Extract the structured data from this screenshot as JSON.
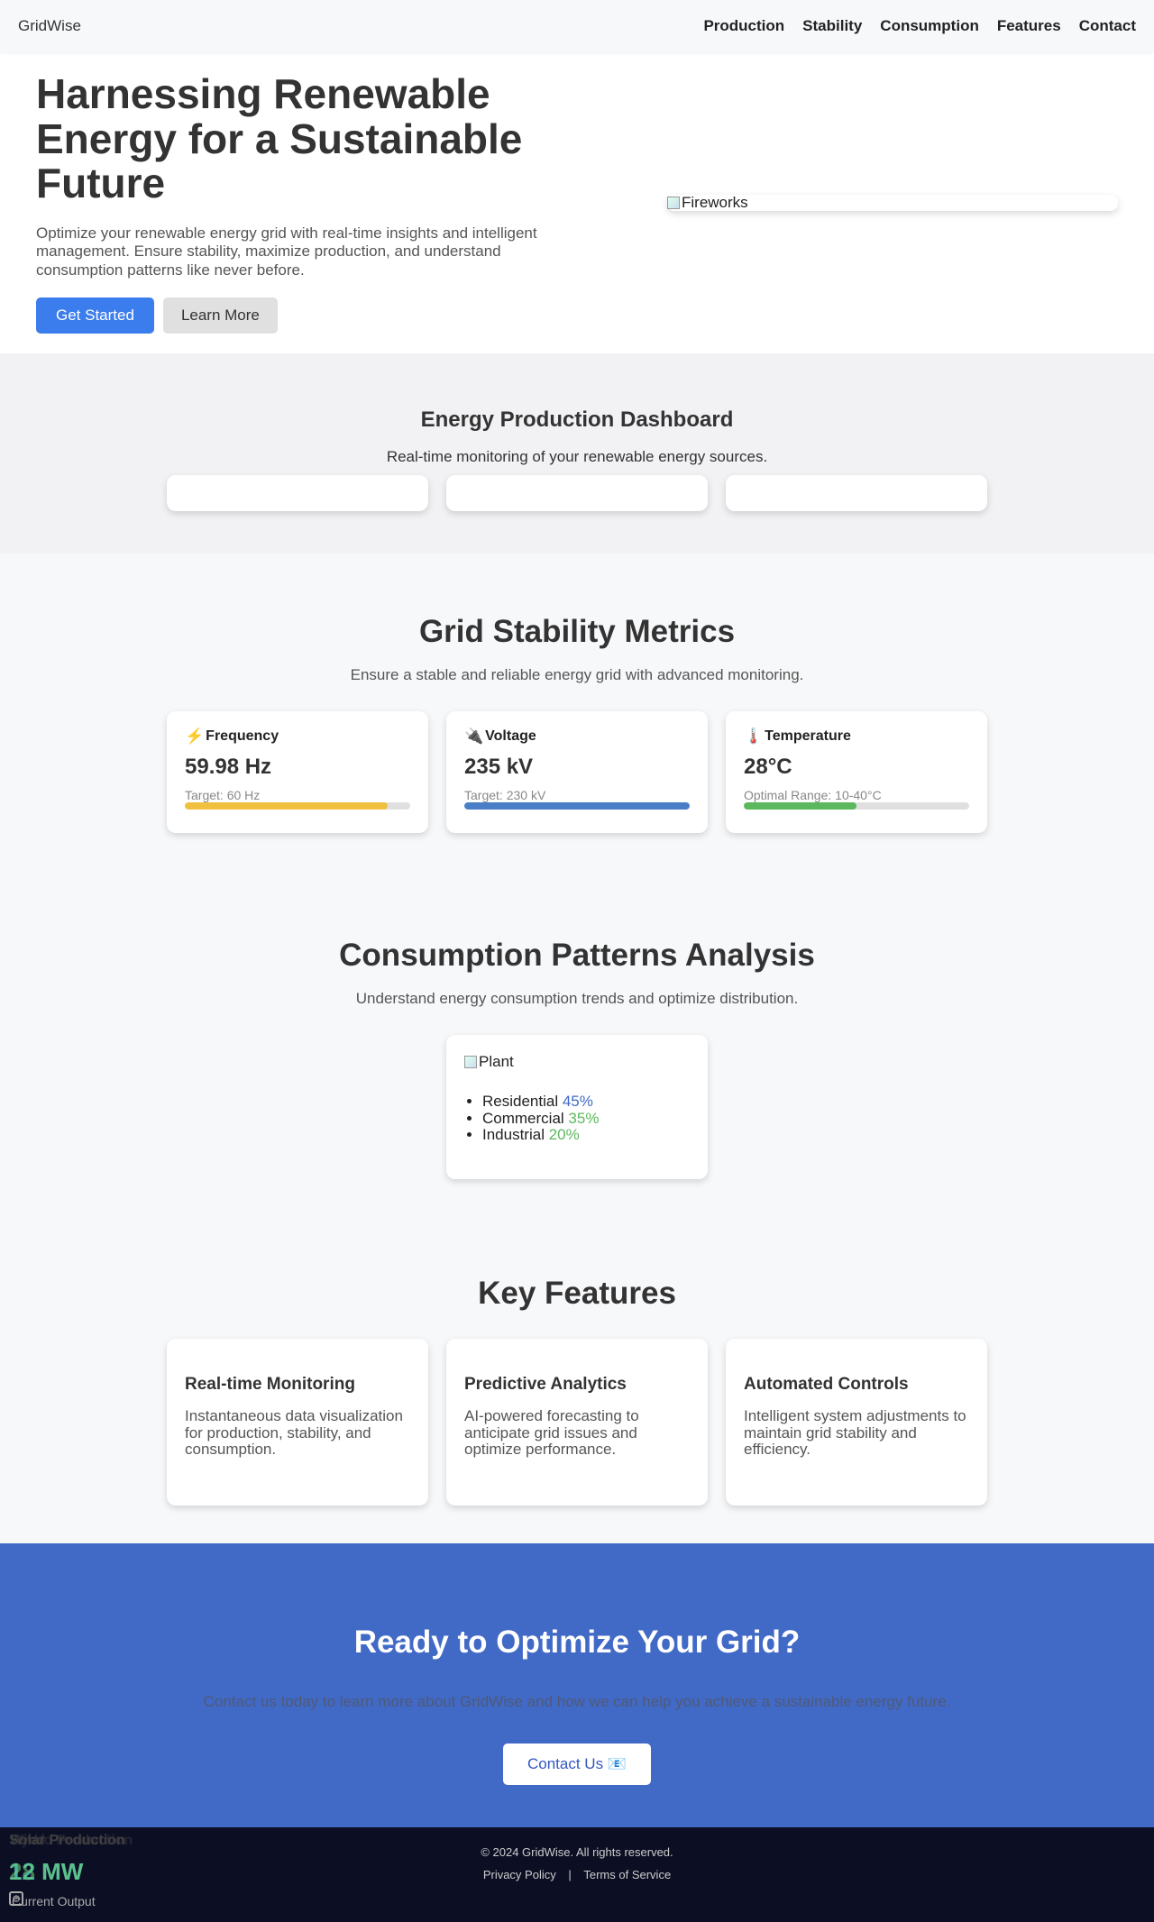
{
  "nav": {
    "brand": "GridWise",
    "links": [
      "Production",
      "Stability",
      "Consumption",
      "Features",
      "Contact"
    ]
  },
  "hero": {
    "title": "Harnessing Renewable Energy for a Sustainable Future",
    "description": "Optimize your renewable energy grid with real-time insights and intelligent management. Ensure stability, maximize production, and understand consumption patterns like never before.",
    "primary_button": "Get Started",
    "secondary_button": "Learn More",
    "image_alt": "Fireworks"
  },
  "production": {
    "title": "Energy Production Dashboard",
    "subtitle": "Real-time monitoring of your renewable energy sources."
  },
  "stability": {
    "title": "Grid Stability Metrics",
    "subtitle": "Ensure a stable and reliable energy grid with advanced monitoring.",
    "metrics": [
      {
        "icon": "⚡",
        "label": "Frequency",
        "value": "59.98 Hz",
        "target": "Target: 60 Hz",
        "fill": 0.9,
        "color": "#f0c040"
      },
      {
        "icon": "🔌",
        "label": "Voltage",
        "value": "235 kV",
        "target": "Target: 230 kV",
        "fill": 1.0,
        "color": "#4a7fc8"
      },
      {
        "icon": "🌡️",
        "label": "Temperature",
        "value": "28°C",
        "target": "Optimal Range: 10-40°C",
        "fill": 0.5,
        "color": "#5cb85c"
      }
    ]
  },
  "consumption": {
    "title": "Consumption Patterns Analysis",
    "subtitle": "Understand energy consumption trends and optimize distribution.",
    "image_alt": "Plant",
    "items": [
      {
        "label": "Residential",
        "value": "45%",
        "color": "#4169c6"
      },
      {
        "label": "Commercial",
        "value": "35%",
        "color": "#5cb85c"
      },
      {
        "label": "Industrial",
        "value": "20%",
        "color": "#5cb85c"
      }
    ]
  },
  "features": {
    "title": "Key Features",
    "cards": [
      {
        "title": "Real-time Monitoring",
        "text": "Instantaneous data visualization for production, stability, and consumption."
      },
      {
        "title": "Predictive Analytics",
        "text": "AI-powered forecasting to anticipate grid issues and optimize performance."
      },
      {
        "title": "Automated Controls",
        "text": "Intelligent system adjustments to maintain grid stability and efficiency."
      }
    ]
  },
  "cta": {
    "title": "Ready to Optimize Your Grid?",
    "text": "Contact us today to learn more about GridWise and how we can help you achieve a sustainable energy future.",
    "button": "Contact Us 📧"
  },
  "footer": {
    "copyright": "© 2024 GridWise. All rights reserved.",
    "privacy": "Privacy Policy",
    "separator": "|",
    "terms": "Terms of Service"
  },
  "overlay": {
    "labels": [
      "Solar Production",
      "Wind Production",
      "Hydro Production"
    ],
    "values": [
      "12 MW",
      "28 MW"
    ],
    "sub": "Current Output"
  }
}
